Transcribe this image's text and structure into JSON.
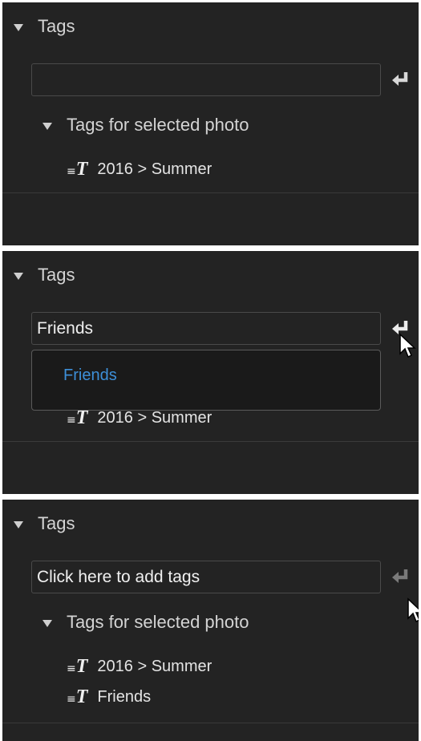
{
  "panels": [
    {
      "section_title": "Tags",
      "input_value": "",
      "subsection_title": "Tags for selected photo",
      "tags": [
        "2016 > Summer"
      ]
    },
    {
      "section_title": "Tags",
      "input_value": "Friends",
      "dropdown_suggestion": "Friends",
      "tags": [
        "2016 > Summer"
      ]
    },
    {
      "section_title": "Tags",
      "input_placeholder": "Click here to add tags",
      "subsection_title": "Tags for selected photo",
      "tags": [
        "2016 > Summer",
        "Friends"
      ]
    }
  ],
  "icons": {
    "collapse": "triangle-down-icon",
    "enter": "enter-return-icon",
    "tag": "text-tag-icon",
    "cursor": "mouse-pointer-icon"
  },
  "colors": {
    "panel_bg": "#232323",
    "text": "#d4d4d4",
    "suggestion_blue": "#3d8fd8",
    "input_border": "#4a4a4a"
  }
}
